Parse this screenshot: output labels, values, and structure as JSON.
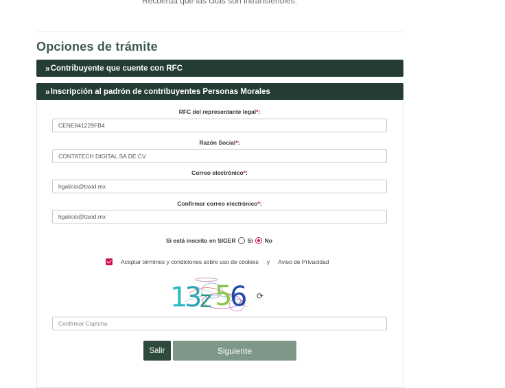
{
  "top_note": "Recuerda que las citas son intransferibles.",
  "section_title": "Opciones de trámite",
  "accordion": [
    {
      "label": "Contribuyente que cuente con RFC"
    },
    {
      "label": "Inscripción al padrón de contribuyentes Personas Morales"
    }
  ],
  "form": {
    "rfc_label": "RFC del representante legal",
    "rfc_value": "CENE841229FB4",
    "razon_label": "Razón Social",
    "razon_value": "CONTATECH DIGITAL SA DE CV",
    "email_label": "Correo electrónico",
    "email_value": "hgalicia@taxid.mx",
    "confirm_email_label": "Confirmar correo electrónico",
    "confirm_email_value": "hgalicia@taxid.mx",
    "required_mark": "*",
    "siger_question": "Si está inscrito en SIGER",
    "siger_yes": "Si",
    "siger_no": "No",
    "siger_selected": "No",
    "terms_text": "Aceptar términos y condiciones sobre uso de cookies",
    "terms_conjunction": "y",
    "privacy_link": "Aviso de Privacidad",
    "terms_checked": true,
    "captcha_text": "13z56",
    "captcha_placeholder": "Confirmar Captcha"
  },
  "buttons": {
    "exit": "Salir",
    "next": "Siguiente"
  },
  "colors": {
    "header_bg": "#253c33",
    "title": "#3c5a4a",
    "accent": "#d0104c",
    "exit_button": "#2d4a3d",
    "next_button": "#7f9789"
  }
}
